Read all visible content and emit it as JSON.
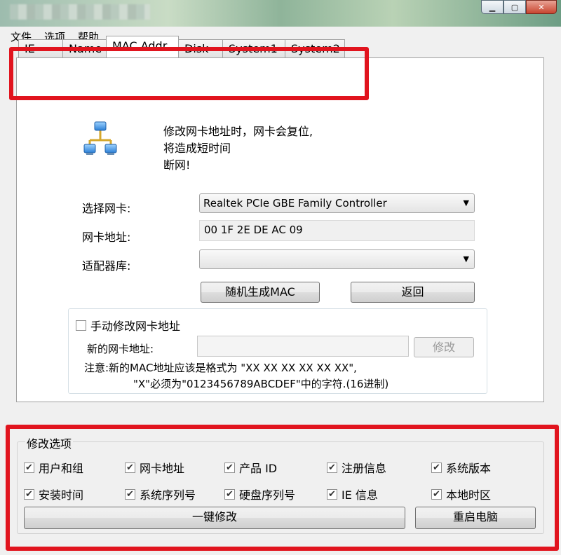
{
  "menu": [
    "文件",
    "选项",
    "帮助"
  ],
  "tabs": [
    "IE",
    "Name",
    "MAC Addr",
    "Disk",
    "System1",
    "System2"
  ],
  "active_tab": 2,
  "warning_lines": [
    "修改网卡地址时，网卡会复位,",
    "将造成短时间",
    "断网!"
  ],
  "form": {
    "select_nic_label": "选择网卡:",
    "select_nic_value": "Realtek PCIe GBE Family Controller",
    "nic_addr_label": "网卡地址:",
    "nic_addr_value": "00 1F 2E DE AC 09",
    "adapter_lib_label": "适配器库:",
    "adapter_lib_value": "",
    "random_btn": "随机生成MAC",
    "back_btn": "返回"
  },
  "manual": {
    "checkbox_label": "手动修改网卡地址",
    "checked": false,
    "new_addr_label": "新的网卡地址:",
    "new_addr_value": "",
    "modify_btn": "修改",
    "note1": "注意:新的MAC地址应该是格式为 \"XX XX XX XX XX XX\",",
    "note2": "\"X\"必须为\"0123456789ABCDEF\"中的字符.(16进制)"
  },
  "options": {
    "title": "修改选项",
    "items": [
      {
        "label": "用户和组",
        "checked": true
      },
      {
        "label": "网卡地址",
        "checked": true
      },
      {
        "label": "产品 ID",
        "checked": true
      },
      {
        "label": "注册信息",
        "checked": true
      },
      {
        "label": "系统版本",
        "checked": true
      },
      {
        "label": "安装时间",
        "checked": true
      },
      {
        "label": "系统序列号",
        "checked": true
      },
      {
        "label": "硬盘序列号",
        "checked": true
      },
      {
        "label": "IE 信息",
        "checked": true
      },
      {
        "label": "本地时区",
        "checked": true
      }
    ],
    "one_click_btn": "一键修改",
    "restart_btn": "重启电脑"
  },
  "colors": {
    "highlight": "#e1141e",
    "window_bg": "#f0f0f0"
  }
}
